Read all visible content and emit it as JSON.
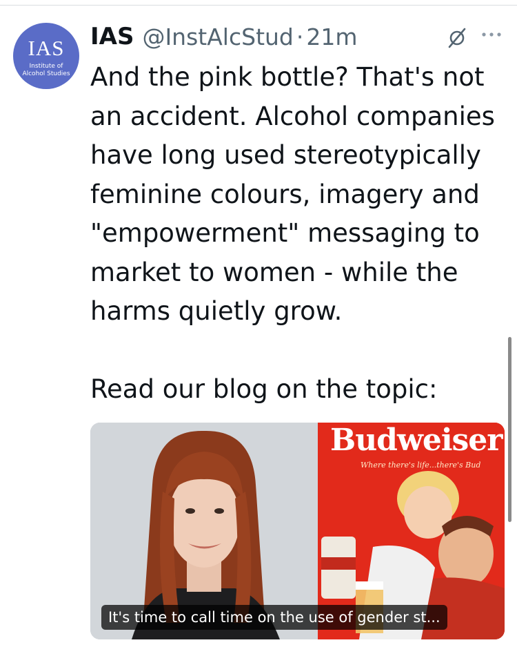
{
  "account": {
    "display_name": "IAS",
    "handle": "@InstAlcStud",
    "separator": "·",
    "time": "21m",
    "avatar_initials": "IAS",
    "avatar_subtitle_line1": "Institute of",
    "avatar_subtitle_line2": "Alcohol Studies",
    "avatar_color": "#5a6cc7"
  },
  "tweet": {
    "paragraph1": "And the pink bottle? That's not an accident. Alcohol companies have long used stereotypically feminine colours, imagery and \"empowerment\" messaging to market to women - while the harms quietly grow.",
    "paragraph2": "Read our blog on the topic:"
  },
  "link_card": {
    "caption": "It's time to call time on the use of gender st...",
    "image_right_brand": "Budweiser",
    "image_right_tagline": "Where there's life...there's Bud"
  },
  "icons": {
    "mute": "muted-circle-slash-icon",
    "more": "more-horizontal-icon"
  },
  "colors": {
    "text_primary": "#0f1419",
    "text_secondary": "#536471",
    "ad_red": "#e22a1b"
  }
}
